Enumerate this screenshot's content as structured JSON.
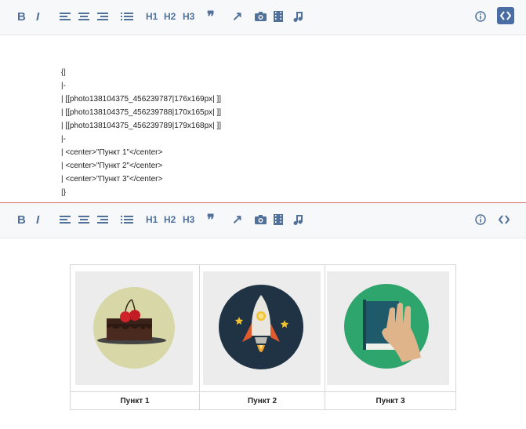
{
  "source_lines": [
    "{|",
    "|-",
    "| [[photo138104375_456239787|176x169px| ]]",
    "| [[photo138104375_456239788|170x165px| ]]",
    "| [[photo138104375_456239789|179x168px| ]]",
    "|-",
    "| <center>\"Пункт 1\"</center>",
    "| <center>\"Пункт 2\"</center>",
    "| <center>\"Пункт 3\"</center>",
    "|}"
  ],
  "table": {
    "cells": [
      {
        "label": "Пункт 1",
        "image": "cake-icon"
      },
      {
        "label": "Пункт 2",
        "image": "rocket-icon"
      },
      {
        "label": "Пункт 3",
        "image": "book-hand-icon"
      }
    ]
  },
  "toolbar": {
    "bold": "B",
    "italic": "I",
    "h1": "H1",
    "h2": "H2",
    "h3": "H3",
    "quote": "❞",
    "link": "↗",
    "icons": [
      "bold-icon",
      "italic-icon",
      "align-left-icon",
      "align-center-icon",
      "align-right-icon",
      "list-icon",
      "h1-icon",
      "h2-icon",
      "h3-icon",
      "quote-icon",
      "link-icon",
      "camera-icon",
      "film-icon",
      "music-icon",
      "info-icon",
      "code-icon"
    ]
  },
  "colors": {
    "accent": "#51719a",
    "active_bg": "#4a6ea3",
    "divider": "#dd6a6a"
  }
}
